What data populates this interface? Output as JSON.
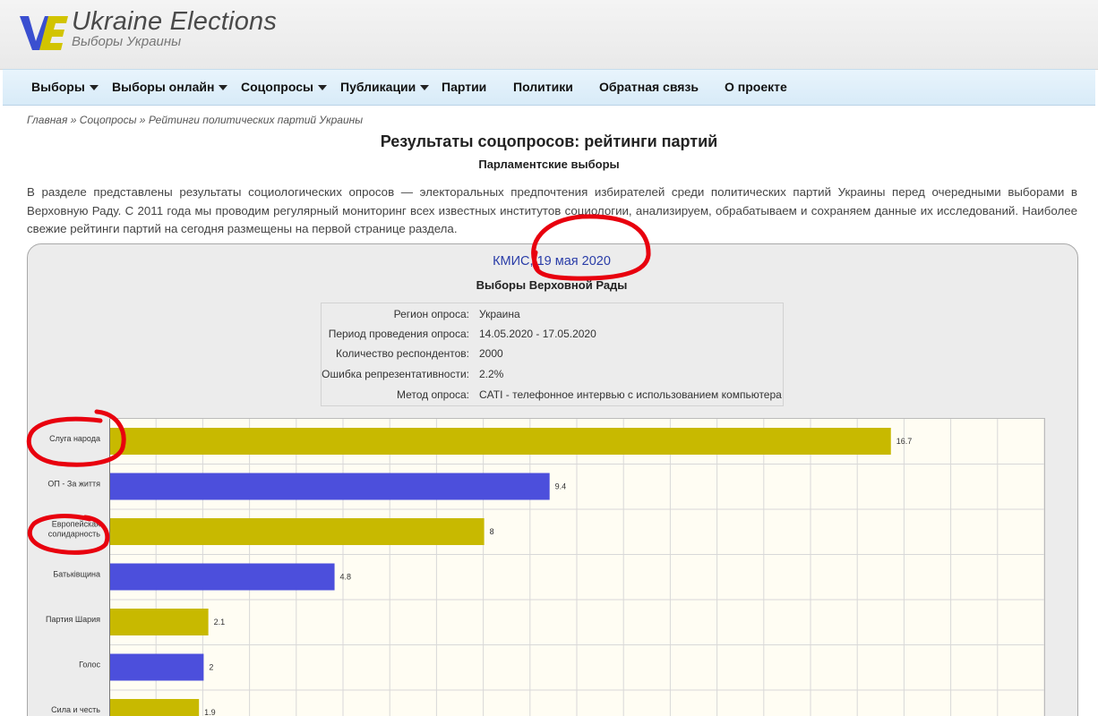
{
  "header": {
    "logo_letters": "VE",
    "title": "Ukraine Elections",
    "subtitle": "Выборы Украины"
  },
  "nav": {
    "items": [
      {
        "label": "Выборы",
        "dropdown": true
      },
      {
        "label": "Выборы онлайн",
        "dropdown": true
      },
      {
        "label": "Соцопросы",
        "dropdown": true
      },
      {
        "label": "Публикации",
        "dropdown": true
      },
      {
        "label": "Партии",
        "dropdown": false
      },
      {
        "label": "Политики",
        "dropdown": false
      },
      {
        "label": "Обратная связь",
        "dropdown": false
      },
      {
        "label": "О проекте",
        "dropdown": false
      }
    ]
  },
  "breadcrumb": {
    "home": "Главная",
    "section": "Соцопросы",
    "current": "Рейтинги политических партий Украины",
    "separator": "»"
  },
  "page": {
    "title": "Результаты соцопросов: рейтинги партий",
    "subtitle": "Парламентские выборы",
    "intro": "В разделе представлены результаты социологических опросов — электоральных предпочтения избирателей среди политических партий Украины перед очередными выборами в Верховную Раду. С 2011 года мы проводим регулярный мониторинг всех известных институтов социологии, анализируем, обрабатываем и сохраняем данные их исследований. Наиболее свежие рейтинги партий на сегодня размещены на первой странице раздела."
  },
  "poll": {
    "title": "КМИС, 19 мая 2020",
    "subtitle": "Выборы Верховной Рады",
    "info": [
      {
        "label": "Регион опроса:",
        "value": "Украина"
      },
      {
        "label": "Период проведения опроса:",
        "value": "14.05.2020 - 17.05.2020"
      },
      {
        "label": "Количество респондентов:",
        "value": "2000"
      },
      {
        "label": "Ошибка репрезентативности:",
        "value": "2.2%"
      },
      {
        "label": "Метод опроса:",
        "value": "CATI - телефонное интервью с использованием компьютера"
      }
    ]
  },
  "colors": {
    "bar_yellow": "#c8b900",
    "bar_blue": "#4c4fdc",
    "annotation": "#e8000e"
  },
  "chart_data": {
    "type": "bar",
    "orientation": "horizontal",
    "categories": [
      "Слуга народа",
      "ОП - За життя",
      "Европейская солидарность",
      "Батьківщина",
      "Партия Шария",
      "Голос",
      "Сила и честь"
    ],
    "category_lines": [
      [
        "Слуга народа"
      ],
      [
        "ОП - За життя"
      ],
      [
        "Европейская",
        "солидарность"
      ],
      [
        "Батьківщина"
      ],
      [
        "Партия Шария"
      ],
      [
        "Голос"
      ],
      [
        "Сила и честь"
      ]
    ],
    "values": [
      16.7,
      9.4,
      8,
      4.8,
      2.1,
      2,
      1.9
    ],
    "value_labels": [
      "16.7",
      "9.4",
      "8",
      "4.8",
      "2.1",
      "2",
      "1.9"
    ],
    "bar_colors": [
      "#c8b900",
      "#4c4fdc",
      "#c8b900",
      "#4c4fdc",
      "#c8b900",
      "#4c4fdc",
      "#c8b900"
    ],
    "xlim": [
      0,
      20
    ],
    "grid": true
  }
}
